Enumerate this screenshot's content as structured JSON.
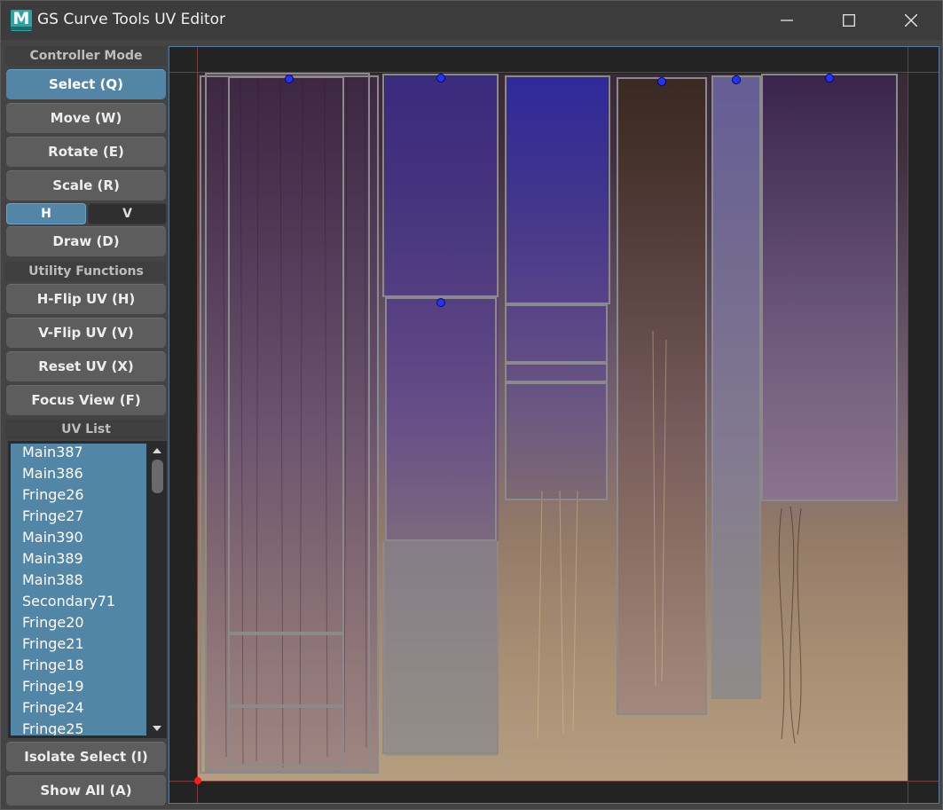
{
  "window": {
    "title": "GS Curve Tools UV Editor",
    "app_icon": "maya-icon",
    "app_icon_letter": "M",
    "controls": [
      "minimize-icon",
      "maximize-icon",
      "close-icon"
    ]
  },
  "controller_mode": {
    "header": "Controller Mode",
    "select": "Select (Q)",
    "move": "Move (W)",
    "rotate": "Rotate (E)",
    "scale": "Scale (R)",
    "h": "H",
    "v": "V",
    "draw": "Draw (D)"
  },
  "utility": {
    "header": "Utility Functions",
    "hflip": "H-Flip UV (H)",
    "vflip": "V-Flip UV (V)",
    "reset": "Reset UV (X)",
    "focus": "Focus View (F)"
  },
  "uv_list": {
    "header": "UV List",
    "items": [
      "Main387",
      "Main386",
      "Fringe26",
      "Fringe27",
      "Main390",
      "Main389",
      "Main388",
      "Secondary71",
      "Fringe20",
      "Fringe21",
      "Fringe18",
      "Fringe19",
      "Fringe24",
      "Fringe25"
    ]
  },
  "bottom": {
    "isolate": "Isolate Select (I)",
    "show_all": "Show All (A)"
  },
  "colors": {
    "accent": "#5285a6",
    "handle": "#2233ff",
    "origin": "#ff1a1a",
    "guide": "#7a3b3b"
  }
}
